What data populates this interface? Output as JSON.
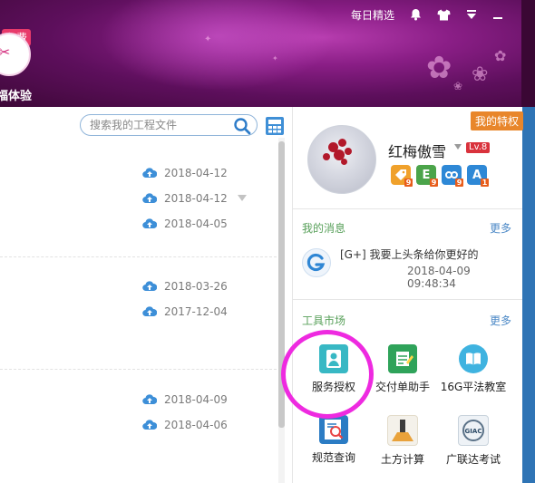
{
  "header": {
    "nav": {
      "daily_picks": "每日精选"
    },
    "promo": {
      "badge": "免费",
      "label": "福体验"
    }
  },
  "files": {
    "search_placeholder": "搜索我的工程文件",
    "groups": [
      {
        "dates": [
          "2018-04-12",
          "2018-04-12",
          "2018-04-05"
        ]
      },
      {
        "dates": [
          "2018-03-26",
          "2017-12-04"
        ]
      },
      {
        "dates": [
          "2018-04-09",
          "2018-04-06"
        ]
      }
    ]
  },
  "profile": {
    "privilege": "我的特权",
    "username": "红梅傲雪",
    "level": "Lv.8",
    "app_icons": [
      {
        "name": "tag-app-icon",
        "letter": "",
        "color": "#f0a12b",
        "sub": "9"
      },
      {
        "name": "e-app-icon",
        "letter": "E",
        "color": "#4ba44a",
        "sub": "9"
      },
      {
        "name": "puzzle-app-icon",
        "letter": "",
        "color": "#2e88d6",
        "sub": "9"
      },
      {
        "name": "a-app-icon",
        "letter": "A",
        "color": "#2e88d6",
        "sub": "1"
      }
    ]
  },
  "messages": {
    "title": "我的消息",
    "more": "更多",
    "item": {
      "text": "[G+] 我要上头条给你更好的",
      "time": "2018-04-09 09:48:34"
    }
  },
  "tools": {
    "title": "工具市场",
    "more": "更多",
    "items": [
      {
        "label": "服务授权",
        "icon": "service-authorization-icon",
        "color": "#38b8c4"
      },
      {
        "label": "交付单助手",
        "icon": "delivery-assistant-icon",
        "color": "#2fa35a"
      },
      {
        "label": "16G平法教室",
        "icon": "book-icon",
        "color": "#3fb3e0"
      },
      {
        "label": "规范查询",
        "icon": "spec-search-icon",
        "color": "#2b7cc4"
      },
      {
        "label": "土方计算",
        "icon": "earthwork-icon",
        "color": "#e9a23b"
      },
      {
        "label": "广联达考试",
        "icon": "giac-exam-icon",
        "color": "#c9d3dc"
      }
    ]
  }
}
